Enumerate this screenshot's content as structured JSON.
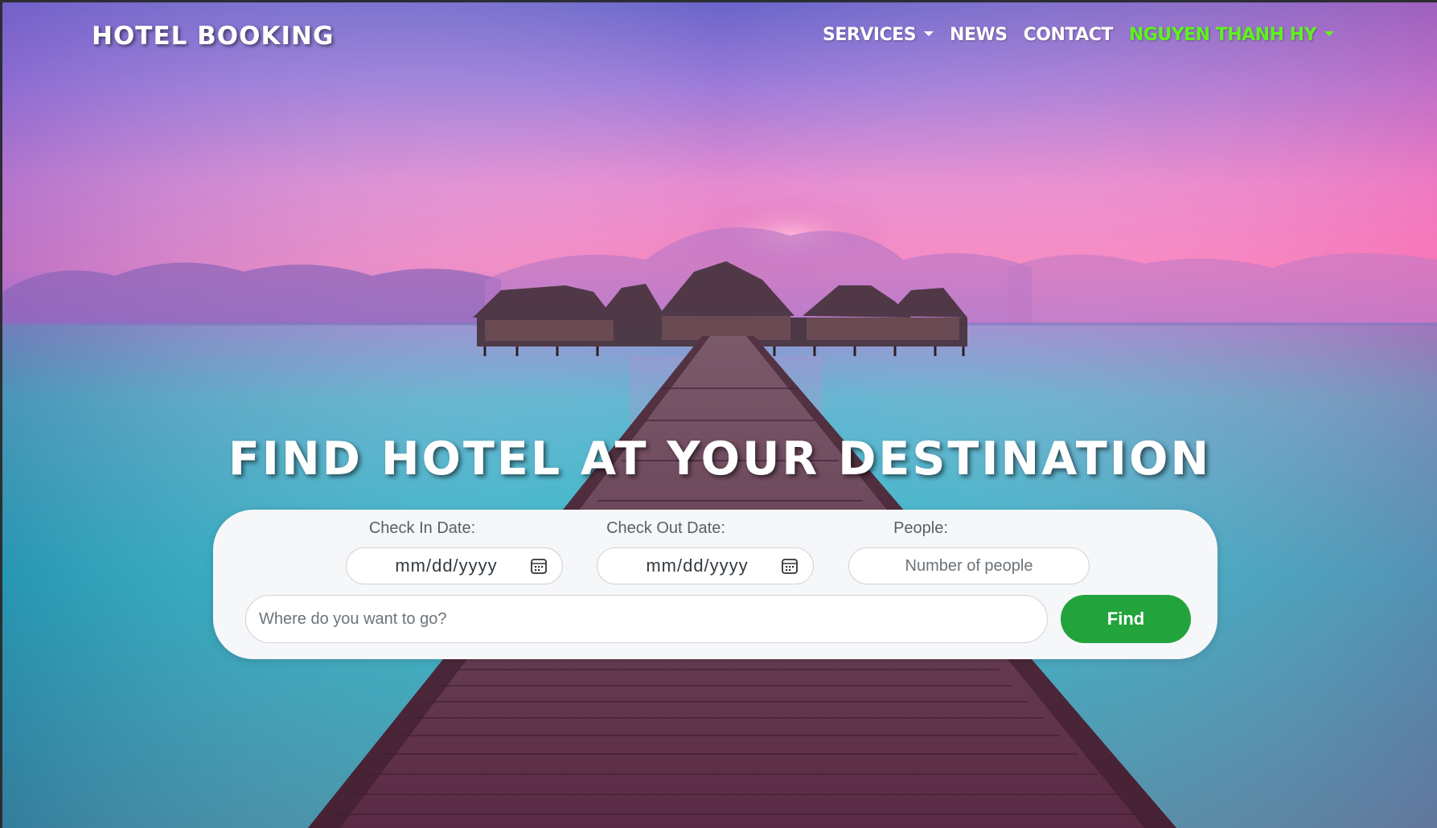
{
  "navbar": {
    "brand": "HOTEL BOOKING",
    "items": [
      {
        "label": "SERVICES",
        "dropdown": true
      },
      {
        "label": "NEWS",
        "dropdown": false
      },
      {
        "label": "CONTACT",
        "dropdown": false
      },
      {
        "label": "NGUYEN THANH HY",
        "dropdown": true
      }
    ],
    "user_color": "#5ef21f"
  },
  "hero": {
    "headline": "FIND HOTEL AT YOUR DESTINATION"
  },
  "search": {
    "check_in_label": "Check In Date:",
    "check_in_value": "mm/dd/yyyy",
    "check_out_label": "Check Out Date:",
    "check_out_value": "mm/dd/yyyy",
    "people_label": "People:",
    "people_placeholder": "Number of people",
    "destination_placeholder": "Where do you want to go?",
    "find_label": "Find",
    "find_color": "#22a33c",
    "calendar_icon": "calendar-icon"
  }
}
